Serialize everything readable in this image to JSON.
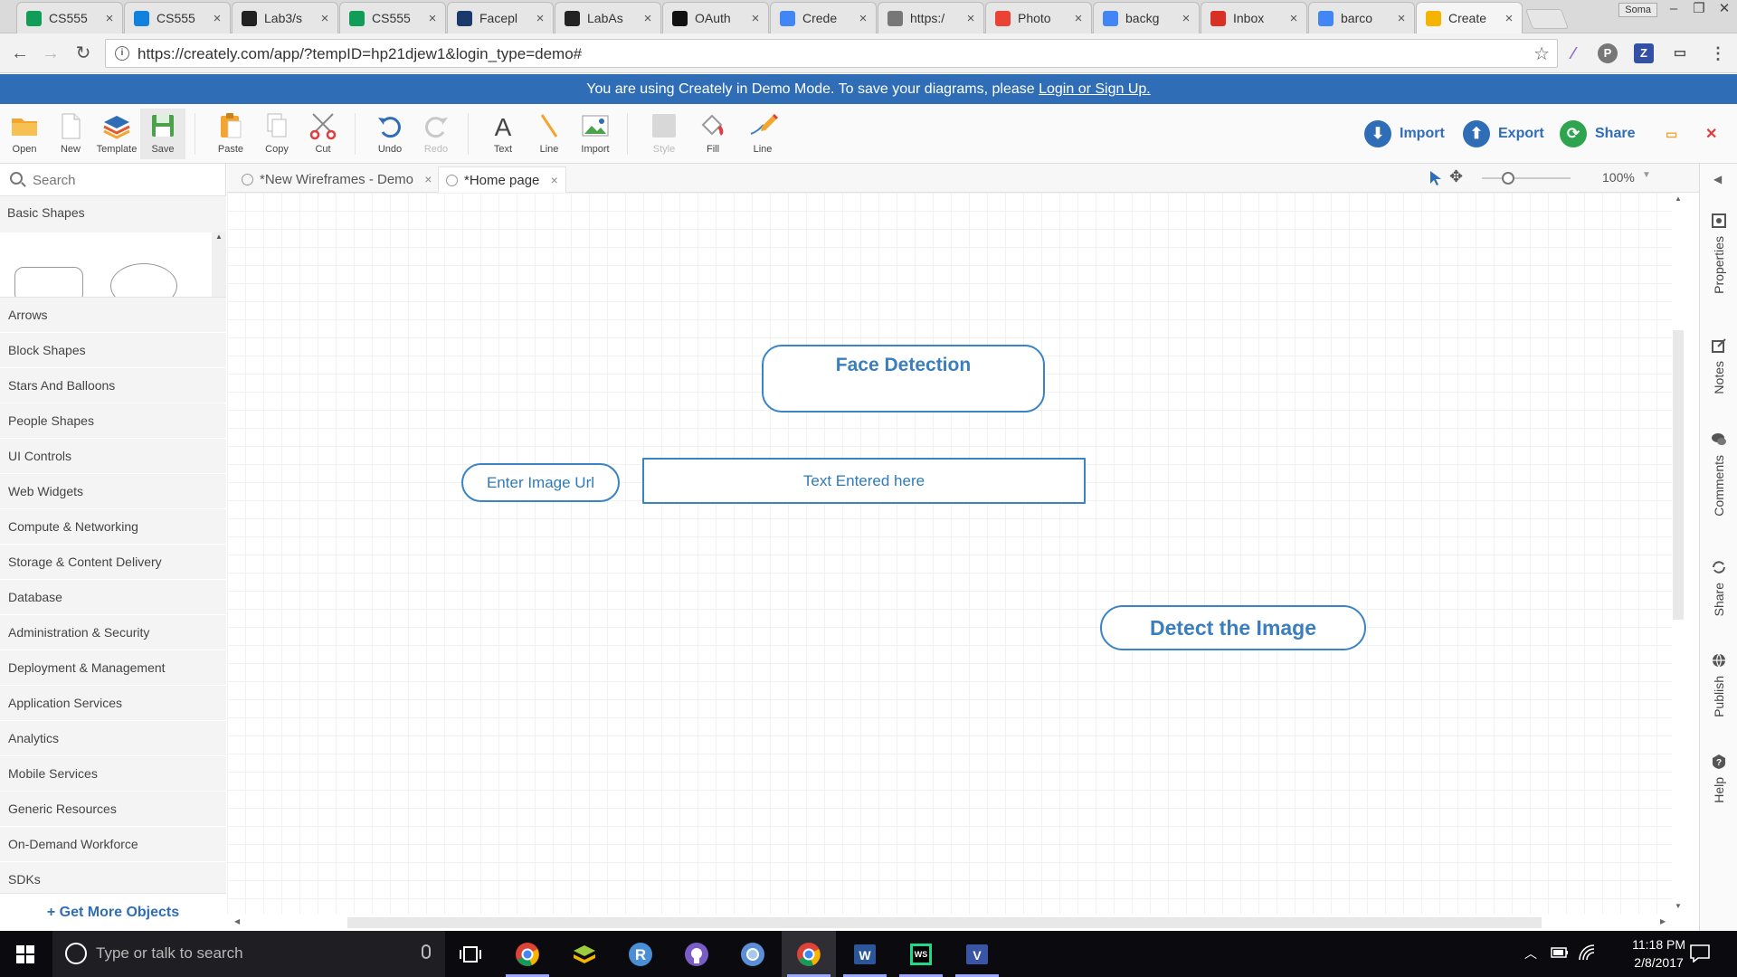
{
  "browser": {
    "tabs": [
      {
        "title": "CS555",
        "icon": "sheets-icon",
        "color": "#0f9d58"
      },
      {
        "title": "CS555",
        "icon": "dropbox-icon",
        "color": "#1081de"
      },
      {
        "title": "Lab3/s",
        "icon": "github-icon",
        "color": "#222222"
      },
      {
        "title": "CS555",
        "icon": "sheets-icon",
        "color": "#0f9d58"
      },
      {
        "title": "Facepl",
        "icon": "faceplusplus-icon",
        "color": "#1a3a6b"
      },
      {
        "title": "LabAs",
        "icon": "github-icon",
        "color": "#222222"
      },
      {
        "title": "OAuth",
        "icon": "auth0-icon",
        "color": "#111111"
      },
      {
        "title": "Crede",
        "icon": "google-icon",
        "color": "#4285f4"
      },
      {
        "title": "https:/",
        "icon": "page-icon",
        "color": "#777777"
      },
      {
        "title": "Photo",
        "icon": "photos-icon",
        "color": "#ea4335"
      },
      {
        "title": "backg",
        "icon": "google-icon",
        "color": "#4285f4"
      },
      {
        "title": "Inbox",
        "icon": "gmail-icon",
        "color": "#d93025"
      },
      {
        "title": "barco",
        "icon": "google-icon",
        "color": "#4285f4"
      },
      {
        "title": "Create",
        "icon": "creately-icon",
        "color": "#f5b400",
        "active": true
      }
    ],
    "close_glyph": "×",
    "user": "Soma",
    "url": "https://creately.com/app/?tempID=hp21djew1&login_type=demo#"
  },
  "banner": {
    "text": "You are using Creately in Demo Mode. To save your diagrams, please ",
    "link": "Login or Sign Up."
  },
  "toolbar": {
    "open": "Open",
    "new": "New",
    "template": "Template",
    "save": "Save",
    "paste": "Paste",
    "copy": "Copy",
    "cut": "Cut",
    "undo": "Undo",
    "redo": "Redo",
    "text": "Text",
    "line": "Line",
    "import": "Import",
    "style": "Style",
    "fill": "Fill",
    "line2": "Line",
    "import_btn": "Import",
    "export_btn": "Export",
    "share_btn": "Share"
  },
  "library": {
    "search_placeholder": "Search",
    "open_category": "Basic Shapes",
    "categories": [
      "Arrows",
      "Block Shapes",
      "Stars And Balloons",
      "People Shapes",
      "UI Controls",
      "Web Widgets",
      "Compute & Networking",
      "Storage & Content Delivery",
      "Database",
      "Administration & Security",
      "Deployment & Management",
      "Application Services",
      "Analytics",
      "Mobile Services",
      "Generic Resources",
      "On-Demand Workforce",
      "SDKs"
    ],
    "get_more": "+ Get More Objects"
  },
  "doc_tabs": [
    {
      "label": "*New Wireframes - Demo"
    },
    {
      "label": "*Home page",
      "active": true
    }
  ],
  "zoom": "100%",
  "diagram": {
    "title": "Face Detection",
    "url_label": "Enter Image Url",
    "text_field": "Text Entered here",
    "detect_button": "Detect the Image"
  },
  "right_rail": [
    "Properties",
    "Notes",
    "Comments",
    "Share",
    "Publish",
    "Help"
  ],
  "taskbar": {
    "search_placeholder": "Type or talk to search",
    "time": "11:18 PM",
    "date": "2/8/2017"
  },
  "colors": {
    "accent": "#2f6db7",
    "diagram_stroke": "#3a83c4",
    "share_green": "#2ea44f"
  }
}
